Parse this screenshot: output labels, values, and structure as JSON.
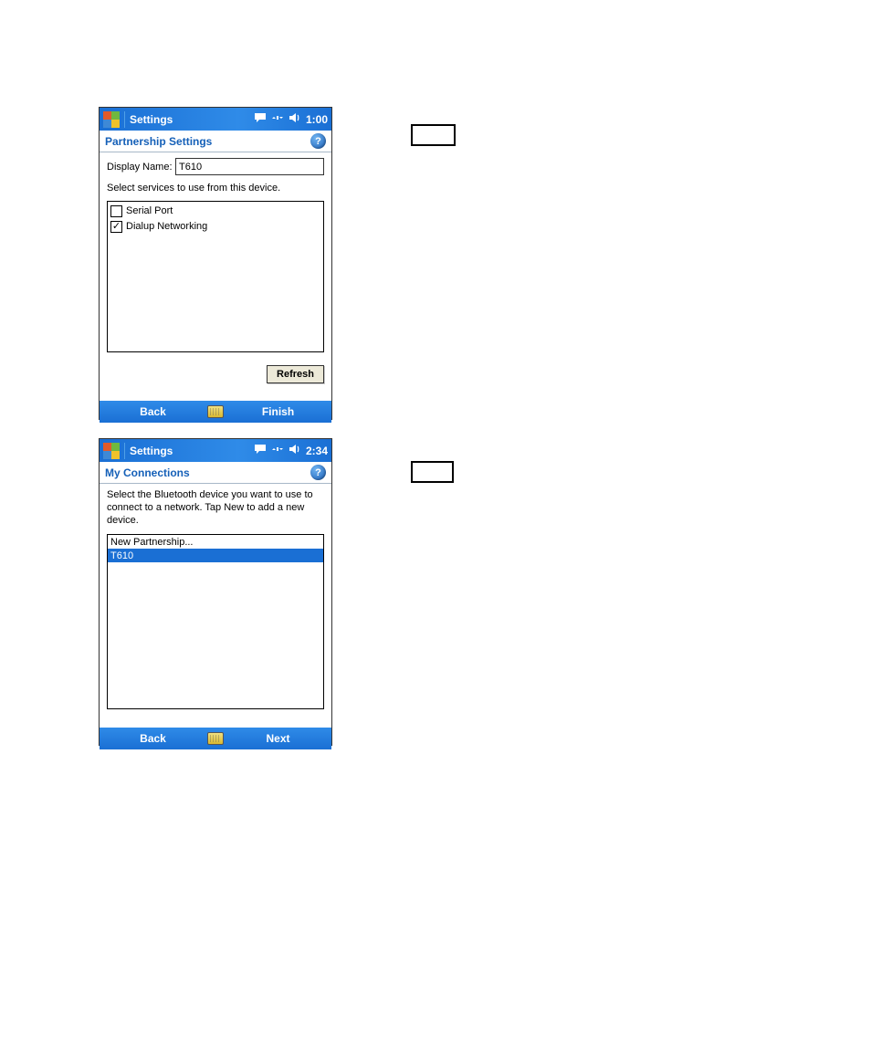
{
  "screen1": {
    "titlebar": {
      "app": "Settings",
      "time": "1:00"
    },
    "sub_title": "Partnership Settings",
    "display_name_label": "Display Name:",
    "display_name_value": "T610",
    "instruction": "Select services to use from this device.",
    "services": [
      {
        "label": "Serial Port",
        "checked": false
      },
      {
        "label": "Dialup Networking",
        "checked": true
      }
    ],
    "refresh_label": "Refresh",
    "menu": {
      "left": "Back",
      "right": "Finish"
    }
  },
  "screen2": {
    "titlebar": {
      "app": "Settings",
      "time": "2:34"
    },
    "sub_title": "My Connections",
    "instruction": "Select the Bluetooth device you want to use to connect to a network. Tap New to add a new device.",
    "devices": [
      {
        "label": "New Partnership...",
        "selected": false
      },
      {
        "label": "T610",
        "selected": true
      }
    ],
    "menu": {
      "left": "Back",
      "right": "Next"
    }
  }
}
